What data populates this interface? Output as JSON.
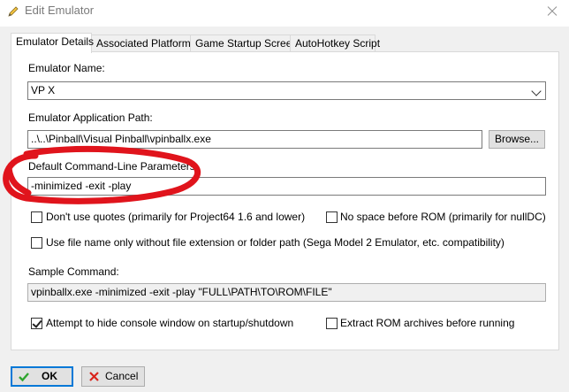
{
  "window": {
    "title": "Edit Emulator",
    "pencil_icon": "pencil-icon",
    "close_icon": "close-icon"
  },
  "tabs": [
    {
      "label": "Emulator Details",
      "active": true
    },
    {
      "label": "Associated Platforms",
      "active": false
    },
    {
      "label": "Game Startup Screen",
      "active": false
    },
    {
      "label": "AutoHotkey Script",
      "active": false
    }
  ],
  "form": {
    "emulator_name_label": "Emulator Name:",
    "emulator_name_value": "VP X",
    "app_path_label": "Emulator Application Path:",
    "app_path_value": "..\\..\\Pinball\\Visual Pinball\\vpinballx.exe",
    "browse_label": "Browse...",
    "cmd_params_label": "Default Command-Line Parameters:",
    "cmd_params_value": "-minimized -exit -play",
    "cb_no_quotes": {
      "label": "Don't use quotes (primarily for Project64 1.6 and lower)",
      "checked": false
    },
    "cb_no_space": {
      "label": "No space before ROM (primarily for nullDC)",
      "checked": false
    },
    "cb_file_name_only": {
      "label": "Use file name only without file extension or folder path (Sega Model 2 Emulator, etc. compatibility)",
      "checked": false
    },
    "sample_cmd_label": "Sample Command:",
    "sample_cmd_value": "vpinballx.exe -minimized -exit -play \"FULL\\PATH\\TO\\ROM\\FILE\"",
    "cb_hide_console": {
      "label": "Attempt to hide console window on startup/shutdown",
      "checked": true
    },
    "cb_extract_rom": {
      "label": "Extract ROM archives before running",
      "checked": false
    }
  },
  "footer": {
    "ok_label": "OK",
    "cancel_label": "Cancel"
  },
  "colors": {
    "annotation": "#e0141c",
    "accent": "#0078d7",
    "ok_check": "#2fa52f",
    "cancel_x": "#d9241c"
  }
}
